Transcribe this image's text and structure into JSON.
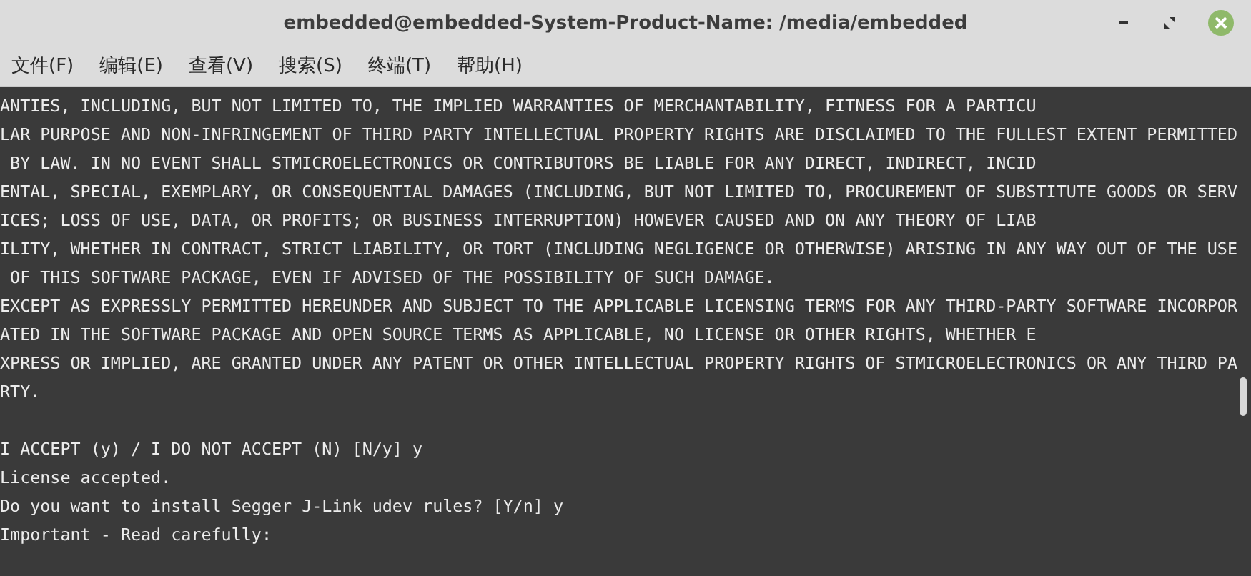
{
  "window": {
    "title": "embedded@embedded-System-Product-Name: /media/embedded"
  },
  "menu": [
    {
      "label": "文件(F)"
    },
    {
      "label": "编辑(E)"
    },
    {
      "label": "查看(V)"
    },
    {
      "label": "搜索(S)"
    },
    {
      "label": "终端(T)"
    },
    {
      "label": "帮助(H)"
    }
  ],
  "terminal": {
    "lines": [
      {
        "kind": "text",
        "text": "ANTIES, INCLUDING, BUT NOT LIMITED TO, THE IMPLIED WARRANTIES OF MERCHANTABILITY, FITNESS FOR A PARTICU"
      },
      {
        "kind": "text",
        "text": "LAR PURPOSE AND NON-INFRINGEMENT OF THIRD PARTY INTELLECTUAL PROPERTY RIGHTS ARE DISCLAIMED TO THE FULLEST EXTENT PERMITTED"
      },
      {
        "kind": "text",
        "text": " BY LAW. IN NO EVENT SHALL STMICROELECTRONICS OR CONTRIBUTORS BE LIABLE FOR ANY DIRECT, INDIRECT, INCID"
      },
      {
        "kind": "text",
        "text": "ENTAL, SPECIAL, EXEMPLARY, OR CONSEQUENTIAL DAMAGES (INCLUDING, BUT NOT LIMITED TO, PROCUREMENT OF SUBSTITUTE GOODS OR SERV"
      },
      {
        "kind": "text",
        "text": "ICES; LOSS OF USE, DATA, OR PROFITS; OR BUSINESS INTERRUPTION) HOWEVER CAUSED AND ON ANY THEORY OF LIAB"
      },
      {
        "kind": "text",
        "text": "ILITY, WHETHER IN CONTRACT, STRICT LIABILITY, OR TORT (INCLUDING NEGLIGENCE OR OTHERWISE) ARISING IN ANY WAY OUT OF THE USE"
      },
      {
        "kind": "text",
        "text": " OF THIS SOFTWARE PACKAGE, EVEN IF ADVISED OF THE POSSIBILITY OF SUCH DAMAGE."
      },
      {
        "kind": "text",
        "text": "EXCEPT AS EXPRESSLY PERMITTED HEREUNDER AND SUBJECT TO THE APPLICABLE LICENSING TERMS FOR ANY THIRD-PARTY SOFTWARE INCORPOR"
      },
      {
        "kind": "text",
        "text": "ATED IN THE SOFTWARE PACKAGE AND OPEN SOURCE TERMS AS APPLICABLE, NO LICENSE OR OTHER RIGHTS, WHETHER E"
      },
      {
        "kind": "text",
        "text": "XPRESS OR IMPLIED, ARE GRANTED UNDER ANY PATENT OR OTHER INTELLECTUAL PROPERTY RIGHTS OF STMICROELECTRONICS OR ANY THIRD PA"
      },
      {
        "kind": "text",
        "text": "RTY."
      },
      {
        "kind": "blank"
      },
      {
        "kind": "text",
        "text": "I ACCEPT (y) / I DO NOT ACCEPT (N) [N/y] y"
      },
      {
        "kind": "text",
        "text": "License accepted."
      },
      {
        "kind": "text",
        "text": "Do you want to install Segger J-Link udev rules? [Y/n] y"
      },
      {
        "kind": "text",
        "text": "Important - Read carefully:"
      }
    ]
  }
}
